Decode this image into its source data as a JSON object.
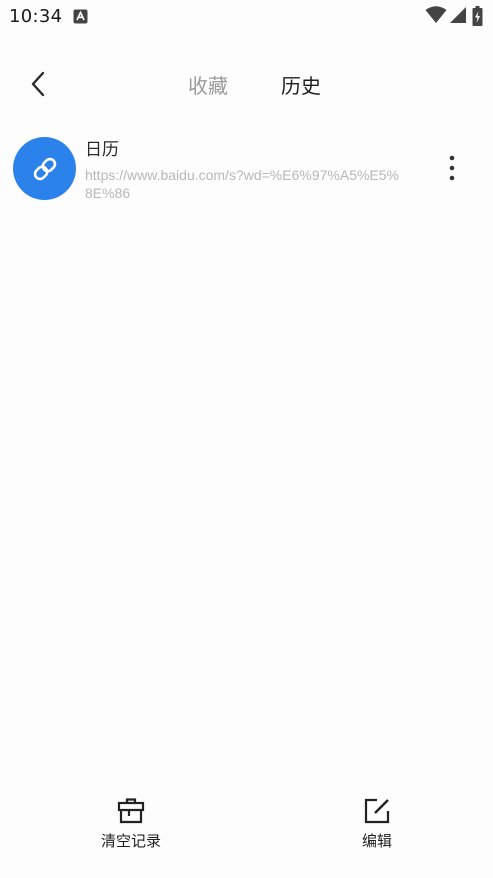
{
  "status_bar": {
    "time": "10:34",
    "notification_icon": "a-letter-icon",
    "icons": [
      "wifi-icon",
      "signal-icon",
      "battery-charging-icon"
    ]
  },
  "header": {
    "back_icon": "chevron-left-icon",
    "tabs": [
      {
        "label": "收藏",
        "active": false
      },
      {
        "label": "历史",
        "active": true
      }
    ]
  },
  "history": [
    {
      "title": "日历",
      "url": "https://www.baidu.com/s?wd=%E6%97%A5%E5%8E%86",
      "icon": "link-icon",
      "more_icon": "more-vertical-icon"
    }
  ],
  "bottom_bar": {
    "clear_label": "清空记录",
    "clear_icon": "trash-icon",
    "edit_label": "编辑",
    "edit_icon": "edit-icon"
  },
  "colors": {
    "accent": "#2b82ea",
    "background": "#fdfdfd",
    "tab_inactive": "#9a9a9a",
    "url_text": "#b8b8b8"
  }
}
